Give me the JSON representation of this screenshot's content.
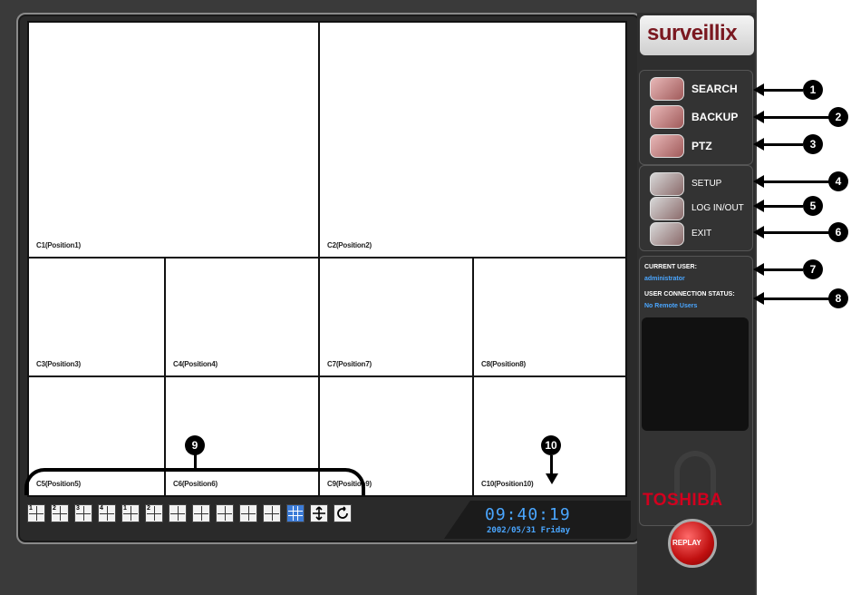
{
  "sidebar": {
    "logo": "surveillix",
    "menu": [
      {
        "label": "SEARCH",
        "icon": "eye-icon"
      },
      {
        "label": "BACKUP",
        "icon": "tape-icon"
      },
      {
        "label": "PTZ",
        "icon": "camera-control-icon"
      },
      {
        "label": "SETUP",
        "icon": "tools-icon"
      },
      {
        "label": "LOG IN/OUT",
        "icon": "keyboard-icon"
      },
      {
        "label": "EXIT",
        "icon": "door-icon"
      }
    ],
    "current_user_title": "CURRENT USER:",
    "current_user": "administrator",
    "connection_title": "USER CONNECTION STATUS:",
    "connection_status": "No Remote Users",
    "brand": "TOSHIBA",
    "replay_label": "REPLAY"
  },
  "cameras": [
    "C1(Position1)",
    "C2(Position2)",
    "C3(Position3)",
    "C4(Position4)",
    "C7(Position7)",
    "C8(Position8)",
    "C5(Position5)",
    "C6(Position6)",
    "C9(Position9)",
    "C10(Position10)"
  ],
  "toolbar": {
    "buttons": [
      "1",
      "2",
      "3",
      "4",
      "1",
      "2",
      "",
      "",
      "",
      "",
      "",
      "",
      "",
      ""
    ]
  },
  "clock": {
    "time": "09:40:19",
    "date": "2002/05/31  Friday"
  },
  "callouts": [
    "1",
    "2",
    "3",
    "4",
    "5",
    "6",
    "7",
    "8",
    "9",
    "10"
  ]
}
